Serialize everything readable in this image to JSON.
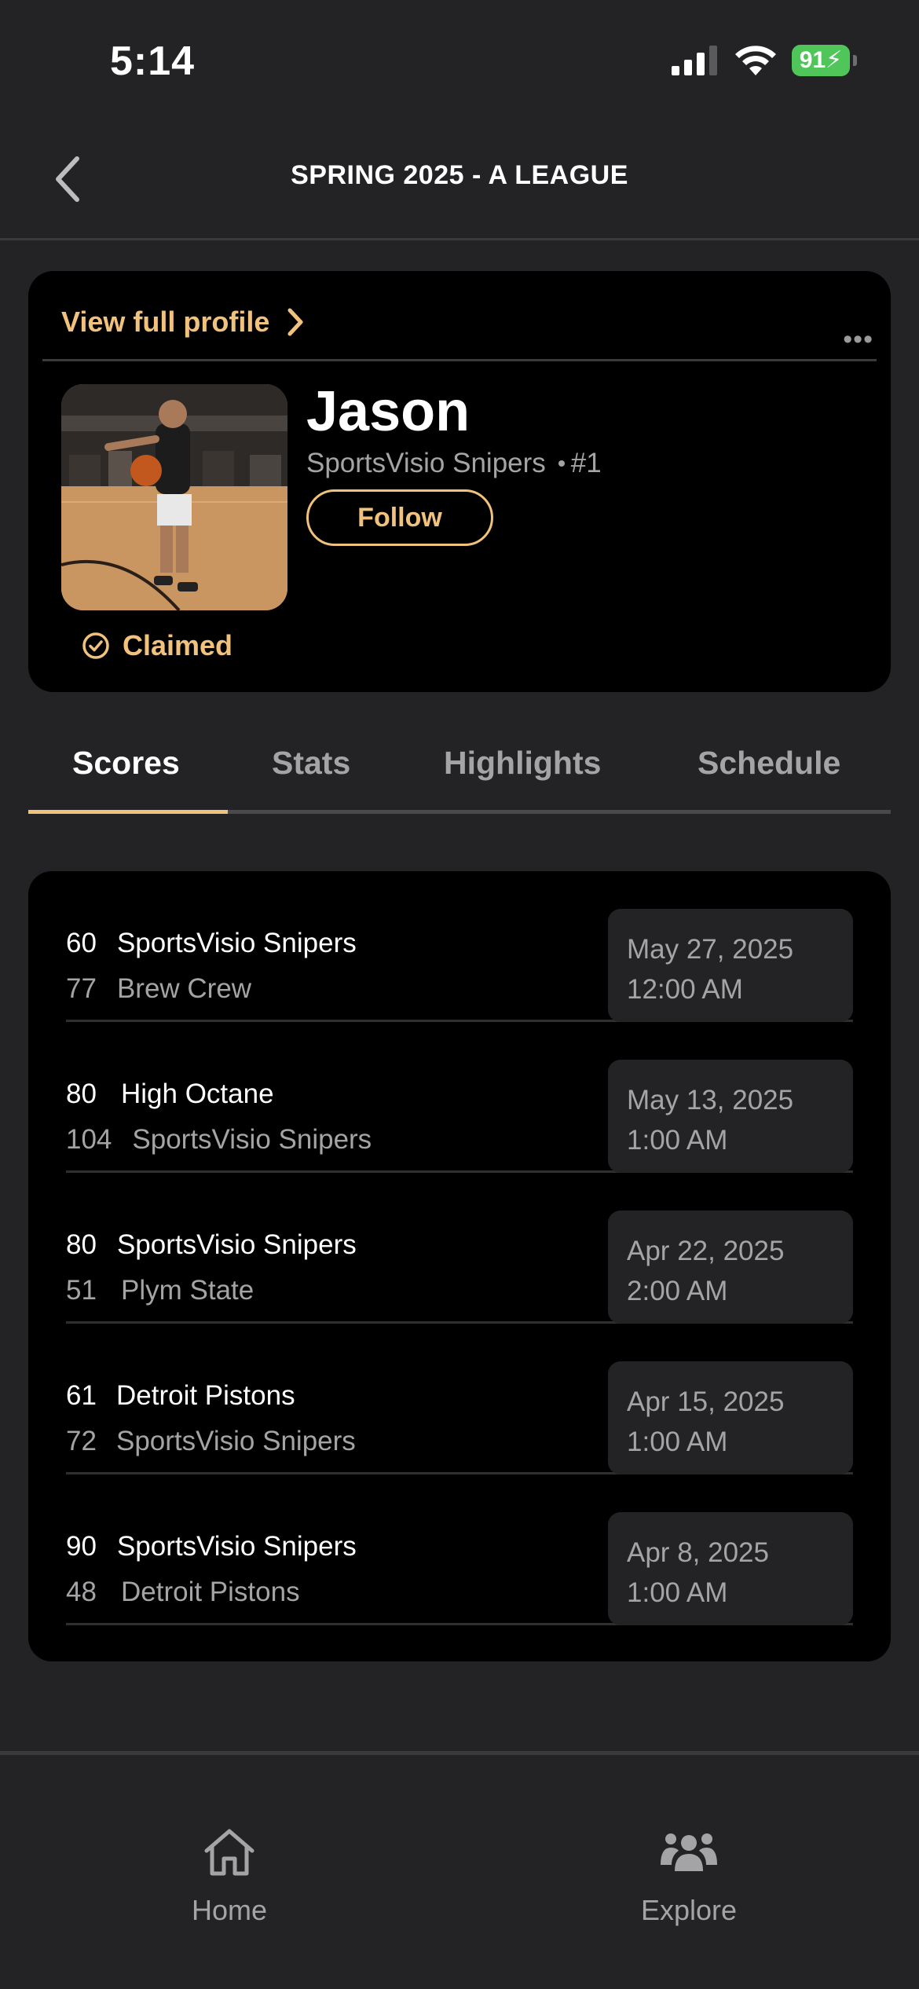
{
  "status_bar": {
    "time": "5:14",
    "battery": "91"
  },
  "header": {
    "title": "SPRING 2025 - A LEAGUE"
  },
  "profile": {
    "view_full_profile": "View full profile",
    "more": "•••",
    "name": "Jason",
    "team": "SportsVisio Snipers",
    "number": "#1",
    "follow_label": "Follow",
    "claimed_label": "Claimed"
  },
  "tabs": [
    {
      "label": "Scores",
      "active": true
    },
    {
      "label": "Stats",
      "active": false
    },
    {
      "label": "Highlights",
      "active": false
    },
    {
      "label": "Schedule",
      "active": false
    }
  ],
  "games": [
    {
      "top_score": "60",
      "top_team": "SportsVisio Snipers",
      "bottom_score": "77",
      "bottom_team": "Brew Crew",
      "date": "May 27, 2025",
      "time": "12:00 AM"
    },
    {
      "top_score": "80",
      "top_team": "High Octane",
      "bottom_score": "104",
      "bottom_team": "SportsVisio Snipers",
      "date": "May 13, 2025",
      "time": "1:00 AM"
    },
    {
      "top_score": "80",
      "top_team": "SportsVisio Snipers",
      "bottom_score": "51",
      "bottom_team": "Plym State",
      "date": "Apr 22, 2025",
      "time": "2:00 AM"
    },
    {
      "top_score": "61",
      "top_team": "Detroit Pistons",
      "bottom_score": "72",
      "bottom_team": "SportsVisio Snipers",
      "date": "Apr 15, 2025",
      "time": "1:00 AM"
    },
    {
      "top_score": "90",
      "top_team": "SportsVisio Snipers",
      "bottom_score": "48",
      "bottom_team": "Detroit Pistons",
      "date": "Apr 8, 2025",
      "time": "1:00 AM"
    }
  ],
  "bottom_nav": [
    {
      "label": "Home",
      "icon": "home-icon"
    },
    {
      "label": "Explore",
      "icon": "people-icon"
    }
  ],
  "colors": {
    "accent": "#f1c27d",
    "background": "#232325",
    "card": "#000000",
    "battery": "#4fc55a"
  }
}
